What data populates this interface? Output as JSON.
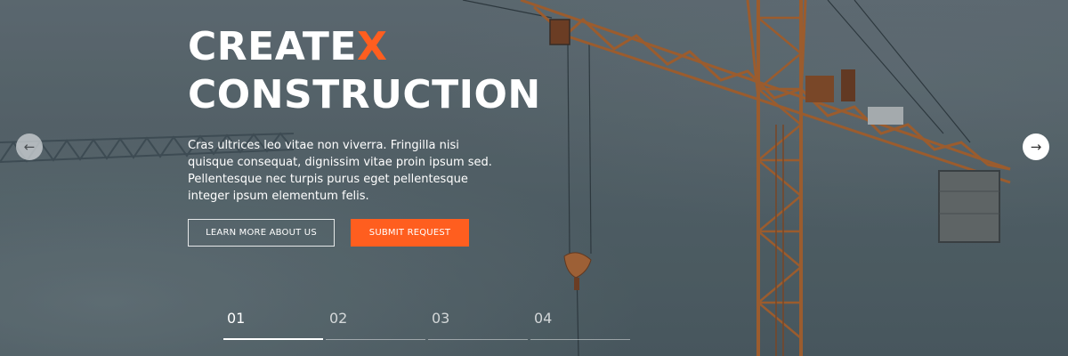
{
  "hero": {
    "title_line1_main": "CREATE",
    "title_line1_accent": "X",
    "title_line2": "CONSTRUCTION",
    "description": "Cras ultrices leo vitae non viverra. Fringilla nisi quisque consequat, dignissim vitae proin ipsum sed. Pellentesque nec turpis purus eget pellentesque integer ipsum elementum felis.",
    "accent_color": "#ff5e1f"
  },
  "buttons": {
    "learn_more": "LEARN MORE ABOUT US",
    "submit_request": "SUBMIT REQUEST"
  },
  "slider": {
    "prev_icon": "←",
    "next_icon": "→",
    "slides": [
      {
        "label": "01",
        "active": true
      },
      {
        "label": "02",
        "active": false
      },
      {
        "label": "03",
        "active": false
      },
      {
        "label": "04",
        "active": false
      }
    ]
  }
}
